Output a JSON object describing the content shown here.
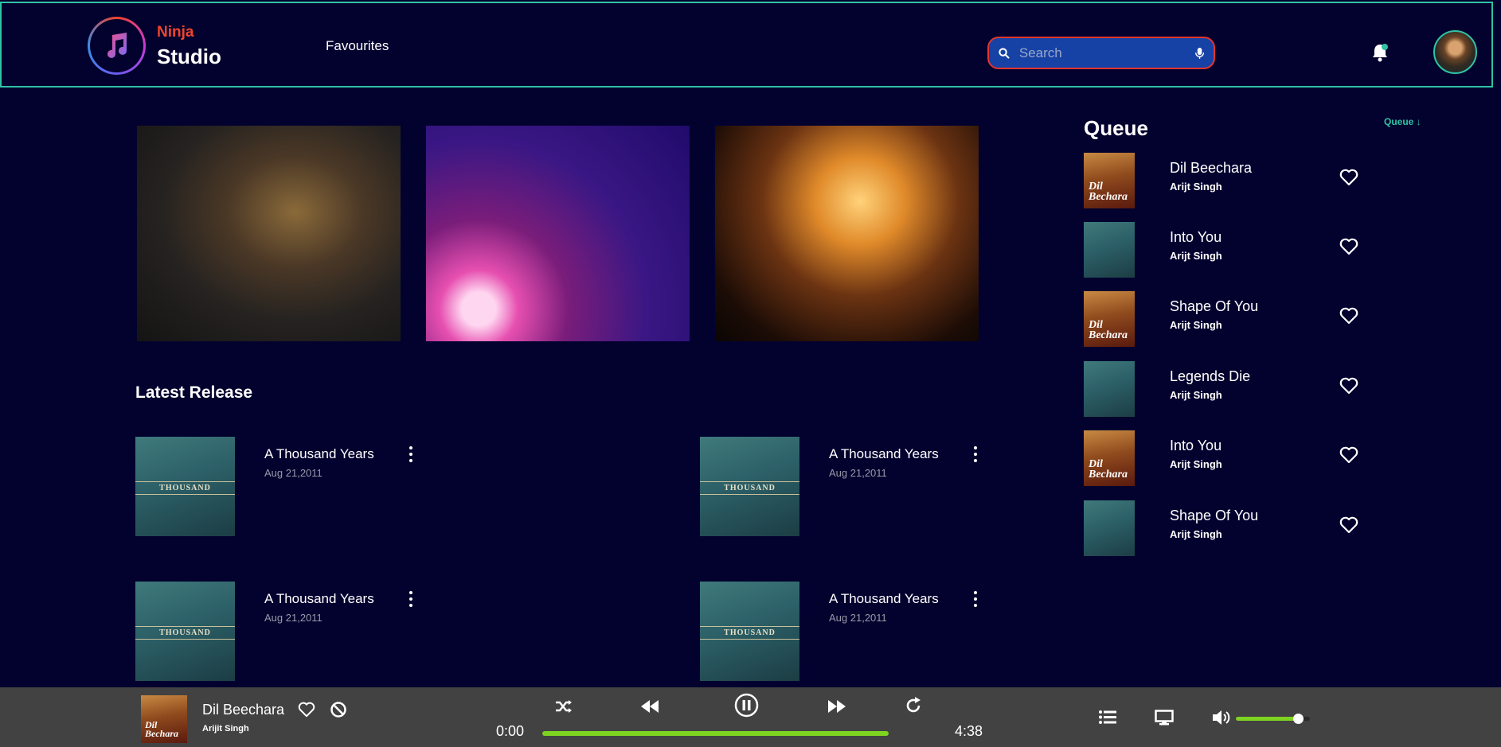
{
  "header": {
    "brand_top": "Ninja",
    "brand_bottom": "Studio",
    "nav_favourites": "Favourites",
    "search_placeholder": "Search"
  },
  "latest": {
    "title": "Latest Release",
    "items": [
      {
        "title": "A Thousand Years",
        "date": "Aug 21,2011",
        "cover_text": "THOUSAND"
      },
      {
        "title": "A Thousand Years",
        "date": "Aug 21,2011",
        "cover_text": "THOUSAND"
      },
      {
        "title": "A Thousand Years",
        "date": "Aug 21,2011",
        "cover_text": "THOUSAND"
      },
      {
        "title": "A Thousand Years",
        "date": "Aug 21,2011",
        "cover_text": "THOUSAND"
      }
    ]
  },
  "queue": {
    "title": "Queue",
    "link": "Queue ↓",
    "items": [
      {
        "name": "Dil Beechara",
        "artist": "Arijt Singh",
        "cover": "dil"
      },
      {
        "name": "Into You",
        "artist": "Arijt Singh",
        "cover": "thou"
      },
      {
        "name": "Shape Of You",
        "artist": "Arijt Singh",
        "cover": "dil"
      },
      {
        "name": "Legends Die",
        "artist": "Arijt Singh",
        "cover": "thou"
      },
      {
        "name": "Into You",
        "artist": "Arijt Singh",
        "cover": "dil"
      },
      {
        "name": "Shape Of You",
        "artist": "Arijt Singh",
        "cover": "thou"
      }
    ]
  },
  "player": {
    "title": "Dil Beechara",
    "artist": "Arijit Singh",
    "cover_text": "Dil Bechara",
    "current_time": "0:00",
    "total_time": "4:38",
    "progress": 1.0,
    "volume": 0.85
  },
  "colors": {
    "background": "#03022f",
    "accent": "#2fc2a4",
    "brand": "#f2442b",
    "search_bg": "#1642a6",
    "progress": "#7ed321",
    "player_bg": "#424242"
  }
}
